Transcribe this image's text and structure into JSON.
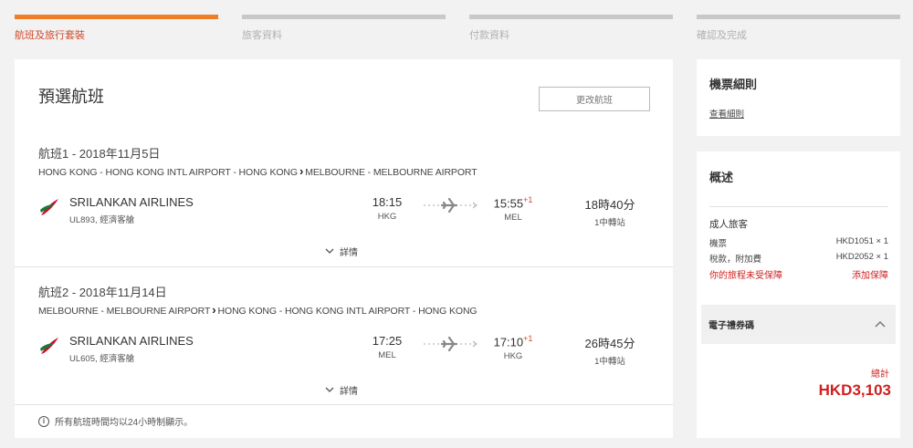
{
  "steps": [
    {
      "label": "航班及旅行套裝",
      "active": true
    },
    {
      "label": "旅客資料",
      "active": false
    },
    {
      "label": "付款資料",
      "active": false
    },
    {
      "label": "確認及完成",
      "active": false
    }
  ],
  "main": {
    "title": "預選航班",
    "change_button": "更改航班",
    "flights": [
      {
        "date": "航班1 - 2018年11月5日",
        "origin": "HONG KONG - HONG KONG INTL AIRPORT - HONG KONG",
        "destination": "MELBOURNE - MELBOURNE AIRPORT",
        "airline": "SRILANKAN AIRLINES",
        "flight_no": "UL893, 經濟客艙",
        "dep_time": "18:15",
        "dep_code": "HKG",
        "arr_time": "15:55",
        "arr_offset": "+1",
        "arr_code": "MEL",
        "duration": "18時40分",
        "stops": "1中轉站",
        "details": "詳情"
      },
      {
        "date": "航班2 - 2018年11月14日",
        "origin": "MELBOURNE - MELBOURNE AIRPORT",
        "destination": "HONG KONG - HONG KONG INTL AIRPORT - HONG KONG",
        "airline": "SRILANKAN AIRLINES",
        "flight_no": "UL605, 經濟客艙",
        "dep_time": "17:25",
        "dep_code": "MEL",
        "arr_time": "17:10",
        "arr_offset": "+1",
        "arr_code": "HKG",
        "duration": "26時45分",
        "stops": "1中轉站",
        "details": "詳情"
      }
    ],
    "footnote": "所有航班時間均以24小時制顯示。"
  },
  "rules": {
    "title": "機票細則",
    "link": "查看細則"
  },
  "summary": {
    "title": "概述",
    "adult_label": "成人旅客",
    "ticket_label": "機票",
    "ticket_value": "HKD1051 × 1",
    "tax_label": "稅款，附加費",
    "tax_value": "HKD2052 × 1",
    "insurance_warning": "你的旅程未受保障",
    "insurance_add": "添加保障",
    "voucher_label": "電子禮券碼",
    "total_label": "總計",
    "total_value": "HKD3,103"
  },
  "colors": {
    "accent": "#f07e26",
    "price_red": "#d01f1f",
    "airline_logo": "#c8102e"
  },
  "icons": {
    "airline_logo": "srilankan-peacock-icon",
    "route_arrow": "chevron-right-icon",
    "flight_path": "plane-icon",
    "details_toggle": "chevron-down-icon",
    "voucher_toggle": "chevron-up-icon",
    "info": "info-icon"
  }
}
